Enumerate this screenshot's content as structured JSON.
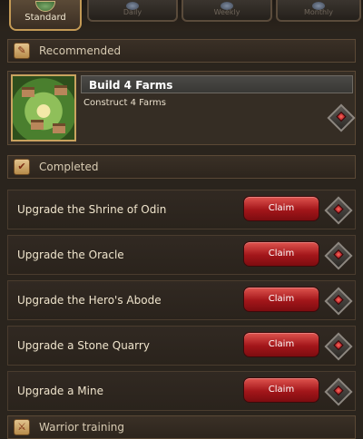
{
  "tabs": [
    {
      "label": "Standard",
      "icon": "scroll-icon",
      "active": true
    },
    {
      "label": "Daily",
      "icon": "daily-icon"
    },
    {
      "label": "Weekly",
      "icon": "weekly-icon"
    },
    {
      "label": "Monthly",
      "icon": "monthly-icon"
    }
  ],
  "recommended": {
    "header": "Recommended",
    "title": "Build 4 Farms",
    "description": "Construct 4 Farms"
  },
  "completed": {
    "header": "Completed",
    "claim_label": "Claim",
    "items": [
      {
        "label": "Upgrade the Shrine of Odin"
      },
      {
        "label": "Upgrade the Oracle"
      },
      {
        "label": "Upgrade the Hero's Abode"
      },
      {
        "label": "Upgrade a Stone Quarry"
      },
      {
        "label": "Upgrade a Mine"
      }
    ]
  },
  "warrior_training": {
    "header": "Warrior training"
  },
  "colors": {
    "accent": "#c49a55",
    "claim": "#b5191e",
    "background": "#2a241d"
  }
}
